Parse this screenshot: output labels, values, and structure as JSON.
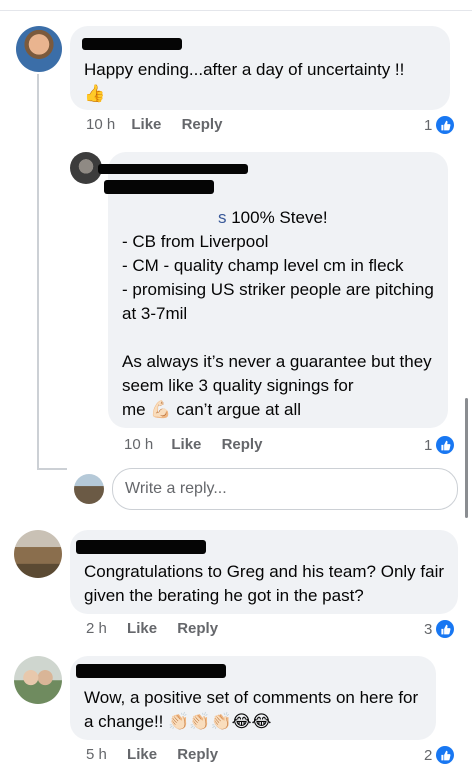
{
  "comments": [
    {
      "text": "Happy ending...after a day of uncertainty !!",
      "time": "10 h",
      "like_label": "Like",
      "reply_label": "Reply",
      "reaction_count": "1",
      "emoji": "👍"
    },
    {
      "mention_tail": "s",
      "text_first": " 100% Steve!",
      "text_body": "- CB from Liverpool\n- CM - quality champ level cm in fleck\n- promising US striker people are pitching at 3-7mil\n\nAs always it’s never a guarantee but they seem like 3 quality signings for\nme",
      "text_tail": " can’t argue at all",
      "emoji": "💪🏻",
      "time": "10 h",
      "like_label": "Like",
      "reply_label": "Reply",
      "reaction_count": "1"
    },
    {
      "text": "Congratulations to Greg and his team? Only fair given the berating he got in the past?",
      "time": "2 h",
      "like_label": "Like",
      "reply_label": "Reply",
      "reaction_count": "3"
    },
    {
      "text": "Wow, a positive set of comments on here for a change!!",
      "emoji": "👏🏻👏🏻👏🏻😂😂",
      "time": "5 h",
      "like_label": "Like",
      "reply_label": "Reply",
      "reaction_count": "2"
    }
  ],
  "reply_input": {
    "placeholder": "Write a reply..."
  },
  "colors": {
    "accent": "#1877f2",
    "bubble": "#f0f2f5",
    "meta": "#65676b"
  },
  "icons": {
    "like_badge": "thumbs-up-icon"
  }
}
